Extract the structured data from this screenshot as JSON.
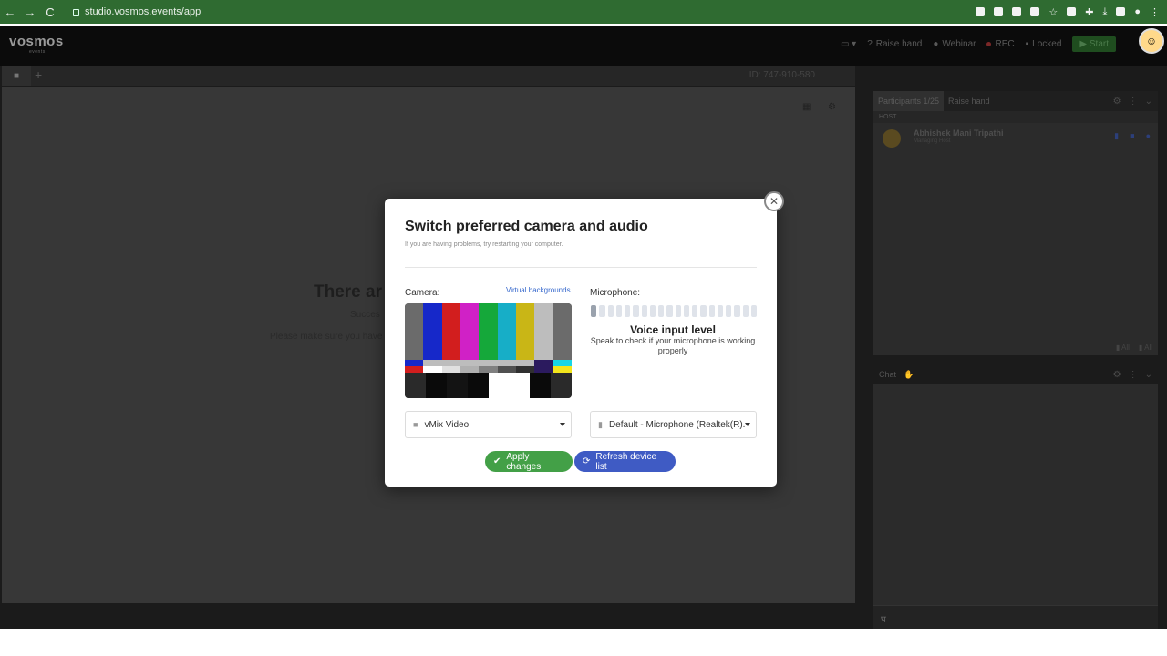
{
  "browser": {
    "url": "studio.vosmos.events/app",
    "back": "←",
    "forward": "→",
    "reload": "C"
  },
  "app": {
    "logo": "vosmos",
    "logo_sub": "events",
    "header": {
      "raise_hand": "Raise hand",
      "webinar": "Webinar",
      "rec": "REC",
      "locked": "Locked",
      "start": "Start"
    },
    "meeting_id": "ID: 747-910-580",
    "stage": {
      "title": "There ar",
      "subtitle": "Succes",
      "hint": "Please make sure you have"
    }
  },
  "participants": {
    "tab_label": "Participants 1/25",
    "raise_hand_tab": "Raise hand",
    "host_label": "HOST",
    "items": [
      {
        "name": "Abhishek Mani Tripathi",
        "role": "Managing Host"
      }
    ],
    "mute_all_1": "All",
    "mute_all_2": "All"
  },
  "chat": {
    "title": "Chat",
    "input_value": "घ"
  },
  "modal": {
    "title": "Switch preferred camera and audio",
    "subtitle": "If you are having problems, try restarting your computer.",
    "camera_label": "Camera:",
    "virtual_backgrounds": "Virtual backgrounds",
    "microphone_label": "Microphone:",
    "voice_level_title": "Voice input level",
    "voice_level_text": "Speak to check if your microphone is working properly",
    "voice_level_fraction": 0.05,
    "camera_select": "vMix Video",
    "mic_select": "Default - Microphone (Realtek(R)...",
    "apply_label": "Apply changes",
    "refresh_label": "Refresh device list"
  },
  "colors": {
    "apply": "#43a047",
    "refresh": "#3f5bc4",
    "link": "#3366cc",
    "browser_bar": "#2f6b31"
  },
  "icons": {
    "close": "close-icon",
    "check": "check-icon",
    "refresh": "refresh-icon",
    "camera": "camera-icon",
    "microphone": "microphone-icon"
  }
}
